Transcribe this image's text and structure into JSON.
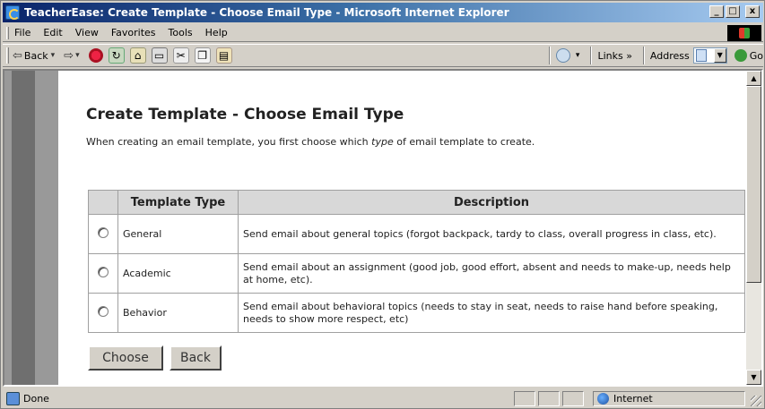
{
  "window": {
    "title": "TeacherEase: Create Template - Choose Email Type - Microsoft Internet Explorer",
    "controls": {
      "minimize": "_",
      "maximize": "□",
      "close": "x"
    }
  },
  "menubar": {
    "items": [
      "File",
      "Edit",
      "View",
      "Favorites",
      "Tools",
      "Help"
    ]
  },
  "toolbar": {
    "back_label": "Back",
    "links_label": "Links »",
    "address_label": "Address",
    "go_label": "Go"
  },
  "page": {
    "title": "Create Template - Choose Email Type",
    "intro_before": "When creating an email template, you first choose which ",
    "intro_emph": "type",
    "intro_after": " of email template to create.",
    "table": {
      "headers": [
        "",
        "Template Type",
        "Description"
      ],
      "rows": [
        {
          "type": "General",
          "description": "Send email about general topics (forgot backpack, tardy to class, overall progress in class, etc)."
        },
        {
          "type": "Academic",
          "description": "Send email about an assignment (good job, good effort, absent and needs to make-up, needs help at home, etc)."
        },
        {
          "type": "Behavior",
          "description": "Send email about behavioral topics (needs to stay in seat, needs to raise hand before speaking, needs to show more respect, etc)"
        }
      ]
    },
    "buttons": {
      "choose": "Choose",
      "back": "Back"
    }
  },
  "statusbar": {
    "status_text": "Done",
    "zone_label": "Internet"
  }
}
